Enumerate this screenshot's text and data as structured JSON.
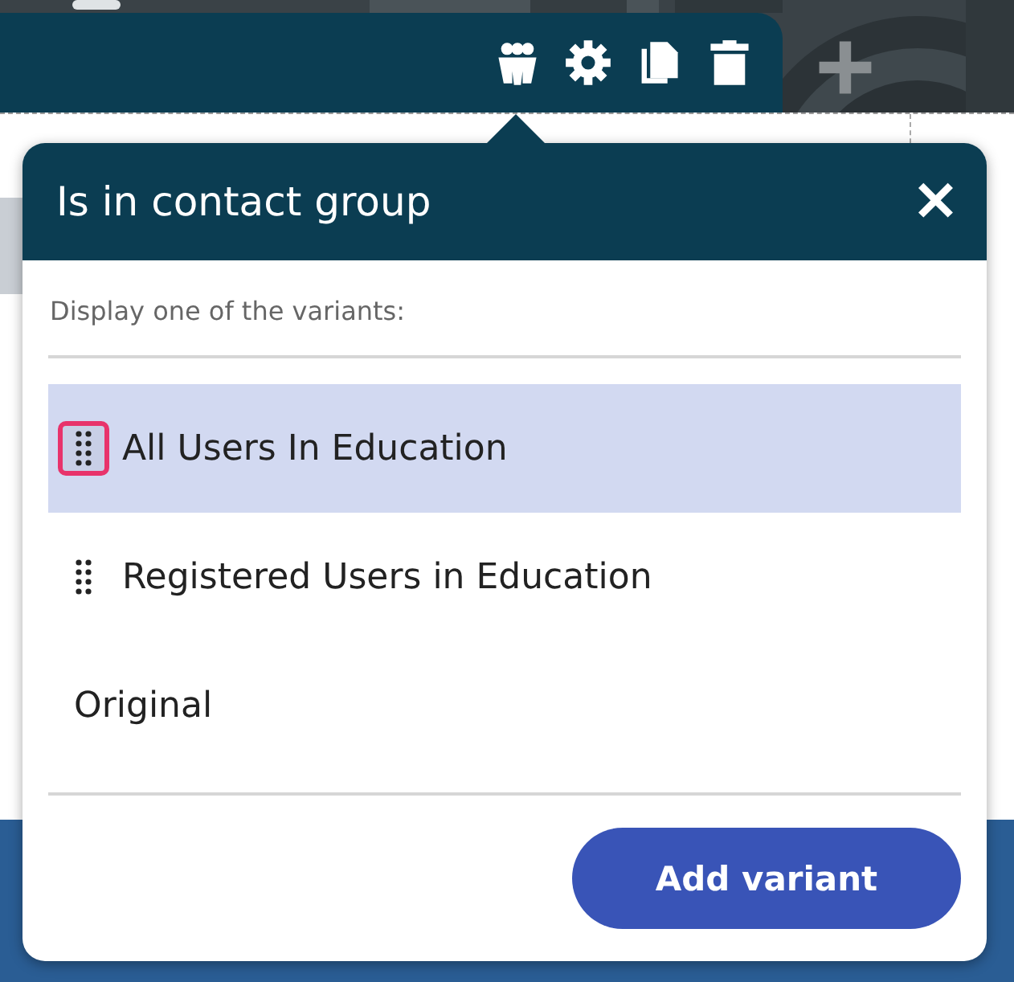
{
  "toolbar": {
    "icons": [
      {
        "kind": "group"
      },
      {
        "kind": "settings"
      },
      {
        "kind": "copy"
      },
      {
        "kind": "delete"
      }
    ]
  },
  "popup": {
    "title": "Is in contact group",
    "close": "✕",
    "instruction": "Display one of the variants:",
    "variants": [
      {
        "label": "All Users In Education",
        "selected": true,
        "draggable": true,
        "focused": true
      },
      {
        "label": "Registered Users in Education",
        "selected": false,
        "draggable": true,
        "focused": false
      },
      {
        "label": "Original",
        "selected": false,
        "draggable": false,
        "focused": false
      }
    ],
    "add_button": "Add variant"
  }
}
